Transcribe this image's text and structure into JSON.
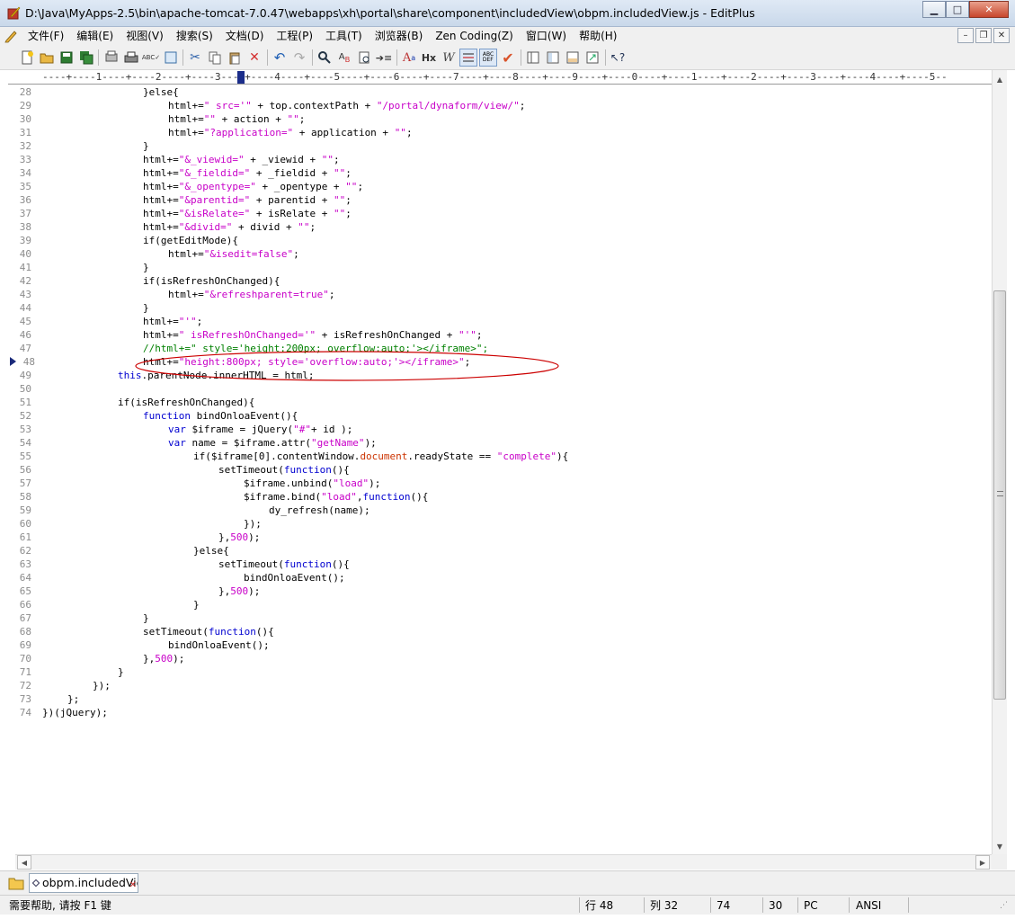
{
  "window": {
    "title": "D:\\Java\\MyApps-2.5\\bin\\apache-tomcat-7.0.47\\webapps\\xh\\portal\\share\\component\\includedView\\obpm.includedView.js - EditPlus",
    "min_label": "▭",
    "max_label": "□",
    "close_label": "✕"
  },
  "menu": {
    "items": [
      "文件(F)",
      "编辑(E)",
      "视图(V)",
      "搜索(S)",
      "文档(D)",
      "工程(P)",
      "工具(T)",
      "浏览器(B)",
      "Zen Coding(Z)",
      "窗口(W)",
      "帮助(H)"
    ]
  },
  "ruler": {
    "text": "----+----1----+----2----+----3----+----4----+----5----+----6----+----7----+----8----+----9----+----0----+----1----+----2----+----3----+----4----+----5--"
  },
  "editor": {
    "current_line_marker": 48,
    "lines": [
      {
        "n": "28",
        "indent": 16,
        "parts": [
          [
            "p",
            "}else{"
          ]
        ]
      },
      {
        "n": "29",
        "indent": 20,
        "parts": [
          [
            "p",
            "html+="
          ],
          [
            "s",
            "\" src='\""
          ],
          [
            "p",
            " + top.contextPath + "
          ],
          [
            "s",
            "\"/portal/dynaform/view/\""
          ],
          [
            "p",
            ";"
          ]
        ]
      },
      {
        "n": "30",
        "indent": 20,
        "parts": [
          [
            "p",
            "html+="
          ],
          [
            "s",
            "\"\""
          ],
          [
            "p",
            " + action + "
          ],
          [
            "s",
            "\"\""
          ],
          [
            "p",
            ";"
          ]
        ]
      },
      {
        "n": "31",
        "indent": 20,
        "parts": [
          [
            "p",
            "html+="
          ],
          [
            "s",
            "\"?application=\""
          ],
          [
            "p",
            " + application + "
          ],
          [
            "s",
            "\"\""
          ],
          [
            "p",
            ";"
          ]
        ]
      },
      {
        "n": "32",
        "indent": 16,
        "parts": [
          [
            "p",
            "}"
          ]
        ]
      },
      {
        "n": "33",
        "indent": 16,
        "parts": [
          [
            "p",
            "html+="
          ],
          [
            "s",
            "\"&_viewid=\""
          ],
          [
            "p",
            " + _viewid + "
          ],
          [
            "s",
            "\"\""
          ],
          [
            "p",
            ";"
          ]
        ]
      },
      {
        "n": "34",
        "indent": 16,
        "parts": [
          [
            "p",
            "html+="
          ],
          [
            "s",
            "\"&_fieldid=\""
          ],
          [
            "p",
            " + _fieldid + "
          ],
          [
            "s",
            "\"\""
          ],
          [
            "p",
            ";"
          ]
        ]
      },
      {
        "n": "35",
        "indent": 16,
        "parts": [
          [
            "p",
            "html+="
          ],
          [
            "s",
            "\"&_opentype=\""
          ],
          [
            "p",
            " + _opentype + "
          ],
          [
            "s",
            "\"\""
          ],
          [
            "p",
            ";"
          ]
        ]
      },
      {
        "n": "36",
        "indent": 16,
        "parts": [
          [
            "p",
            "html+="
          ],
          [
            "s",
            "\"&parentid=\""
          ],
          [
            "p",
            " + parentid + "
          ],
          [
            "s",
            "\"\""
          ],
          [
            "p",
            ";"
          ]
        ]
      },
      {
        "n": "37",
        "indent": 16,
        "parts": [
          [
            "p",
            "html+="
          ],
          [
            "s",
            "\"&isRelate=\""
          ],
          [
            "p",
            " + isRelate + "
          ],
          [
            "s",
            "\"\""
          ],
          [
            "p",
            ";"
          ]
        ]
      },
      {
        "n": "38",
        "indent": 16,
        "parts": [
          [
            "p",
            "html+="
          ],
          [
            "s",
            "\"&divid=\""
          ],
          [
            "p",
            " + divid + "
          ],
          [
            "s",
            "\"\""
          ],
          [
            "p",
            ";"
          ]
        ]
      },
      {
        "n": "39",
        "indent": 16,
        "parts": [
          [
            "p",
            "if(getEditMode){"
          ]
        ]
      },
      {
        "n": "40",
        "indent": 20,
        "parts": [
          [
            "p",
            "html+="
          ],
          [
            "s",
            "\"&isedit=false\""
          ],
          [
            "p",
            ";"
          ]
        ]
      },
      {
        "n": "41",
        "indent": 16,
        "parts": [
          [
            "p",
            "}"
          ]
        ]
      },
      {
        "n": "42",
        "indent": 16,
        "parts": [
          [
            "p",
            "if(isRefreshOnChanged){"
          ]
        ]
      },
      {
        "n": "43",
        "indent": 20,
        "parts": [
          [
            "p",
            "html+="
          ],
          [
            "s",
            "\"&refreshparent=true\""
          ],
          [
            "p",
            ";"
          ]
        ]
      },
      {
        "n": "44",
        "indent": 16,
        "parts": [
          [
            "p",
            "}"
          ]
        ]
      },
      {
        "n": "45",
        "indent": 16,
        "parts": [
          [
            "p",
            "html+="
          ],
          [
            "s",
            "\"'\""
          ],
          [
            "p",
            ";"
          ]
        ]
      },
      {
        "n": "46",
        "indent": 16,
        "parts": [
          [
            "p",
            "html+="
          ],
          [
            "s",
            "\" isRefreshOnChanged='\""
          ],
          [
            "p",
            " + isRefreshOnChanged + "
          ],
          [
            "s",
            "\"'\""
          ],
          [
            "p",
            ";"
          ]
        ]
      },
      {
        "n": "47",
        "indent": 16,
        "parts": [
          [
            "c",
            "//html+=\" style='height:200px; overflow:auto;'></iframe>\";"
          ]
        ]
      },
      {
        "n": "48",
        "indent": 16,
        "parts": [
          [
            "p",
            "html+="
          ],
          [
            "s",
            "\"height:800px; style='overflow:auto;'></iframe>\""
          ],
          [
            "p",
            ";"
          ]
        ]
      },
      {
        "n": "49",
        "indent": 12,
        "parts": [
          [
            "k",
            "this"
          ],
          [
            "p",
            ".parentNode.innerHTML = html;"
          ]
        ]
      },
      {
        "n": "50",
        "indent": 0,
        "parts": []
      },
      {
        "n": "51",
        "indent": 12,
        "parts": [
          [
            "p",
            "if(isRefreshOnChanged){"
          ]
        ]
      },
      {
        "n": "52",
        "indent": 16,
        "parts": [
          [
            "k",
            "function"
          ],
          [
            "p",
            " bindOnloaEvent(){"
          ]
        ]
      },
      {
        "n": "53",
        "indent": 20,
        "parts": [
          [
            "k",
            "var"
          ],
          [
            "p",
            " $iframe = jQuery("
          ],
          [
            "s",
            "\"#\""
          ],
          [
            "p",
            "+ id );"
          ]
        ]
      },
      {
        "n": "54",
        "indent": 20,
        "parts": [
          [
            "k",
            "var"
          ],
          [
            "p",
            " name = $iframe.attr("
          ],
          [
            "s",
            "\"getName\""
          ],
          [
            "p",
            ");"
          ]
        ]
      },
      {
        "n": "55",
        "indent": 24,
        "parts": [
          [
            "p",
            "if($iframe[0].contentWindow."
          ],
          [
            "o",
            "document"
          ],
          [
            "p",
            ".readyState == "
          ],
          [
            "s",
            "\"complete\""
          ],
          [
            "p",
            "){"
          ]
        ]
      },
      {
        "n": "56",
        "indent": 28,
        "parts": [
          [
            "p",
            "setTimeout("
          ],
          [
            "k",
            "function"
          ],
          [
            "p",
            "(){"
          ]
        ]
      },
      {
        "n": "57",
        "indent": 32,
        "parts": [
          [
            "p",
            "$iframe.unbind("
          ],
          [
            "s",
            "\"load\""
          ],
          [
            "p",
            ");"
          ]
        ]
      },
      {
        "n": "58",
        "indent": 32,
        "parts": [
          [
            "p",
            "$iframe.bind("
          ],
          [
            "s",
            "\"load\""
          ],
          [
            "p",
            ","
          ],
          [
            "k",
            "function"
          ],
          [
            "p",
            "(){"
          ]
        ]
      },
      {
        "n": "59",
        "indent": 36,
        "parts": [
          [
            "p",
            "dy_refresh(name);"
          ]
        ]
      },
      {
        "n": "60",
        "indent": 32,
        "parts": [
          [
            "p",
            "});"
          ]
        ]
      },
      {
        "n": "61",
        "indent": 28,
        "parts": [
          [
            "p",
            "},"
          ],
          [
            "n",
            "500"
          ],
          [
            "p",
            ");"
          ]
        ]
      },
      {
        "n": "62",
        "indent": 24,
        "parts": [
          [
            "p",
            "}else{"
          ]
        ]
      },
      {
        "n": "63",
        "indent": 28,
        "parts": [
          [
            "p",
            "setTimeout("
          ],
          [
            "k",
            "function"
          ],
          [
            "p",
            "(){"
          ]
        ]
      },
      {
        "n": "64",
        "indent": 32,
        "parts": [
          [
            "p",
            "bindOnloaEvent();"
          ]
        ]
      },
      {
        "n": "65",
        "indent": 28,
        "parts": [
          [
            "p",
            "},"
          ],
          [
            "n",
            "500"
          ],
          [
            "p",
            ");"
          ]
        ]
      },
      {
        "n": "66",
        "indent": 24,
        "parts": [
          [
            "p",
            "}"
          ]
        ]
      },
      {
        "n": "67",
        "indent": 16,
        "parts": [
          [
            "p",
            "}"
          ]
        ]
      },
      {
        "n": "68",
        "indent": 16,
        "parts": [
          [
            "p",
            "setTimeout("
          ],
          [
            "k",
            "function"
          ],
          [
            "p",
            "(){"
          ]
        ]
      },
      {
        "n": "69",
        "indent": 20,
        "parts": [
          [
            "p",
            "bindOnloaEvent();"
          ]
        ]
      },
      {
        "n": "70",
        "indent": 16,
        "parts": [
          [
            "p",
            "},"
          ],
          [
            "n",
            "500"
          ],
          [
            "p",
            ");"
          ]
        ]
      },
      {
        "n": "71",
        "indent": 12,
        "parts": [
          [
            "p",
            "}"
          ]
        ]
      },
      {
        "n": "72",
        "indent": 8,
        "parts": [
          [
            "p",
            "});"
          ]
        ]
      },
      {
        "n": "73",
        "indent": 4,
        "parts": [
          [
            "p",
            "};"
          ]
        ]
      },
      {
        "n": "74",
        "indent": 0,
        "parts": [
          [
            "p",
            "})(jQuery);"
          ]
        ]
      }
    ]
  },
  "tabs": {
    "file_tab_label": "obpm.includedView.js"
  },
  "status": {
    "help": "需要帮助, 请按 F1 键",
    "line": "行 48",
    "col": "列 32",
    "total_lines": "74",
    "col2": "30",
    "eol": "PC",
    "encoding": "ANSI"
  },
  "colors": {
    "keyword": "#0000d0",
    "string": "#c800c8",
    "comment": "#008000",
    "annotation": "#cc0000"
  }
}
